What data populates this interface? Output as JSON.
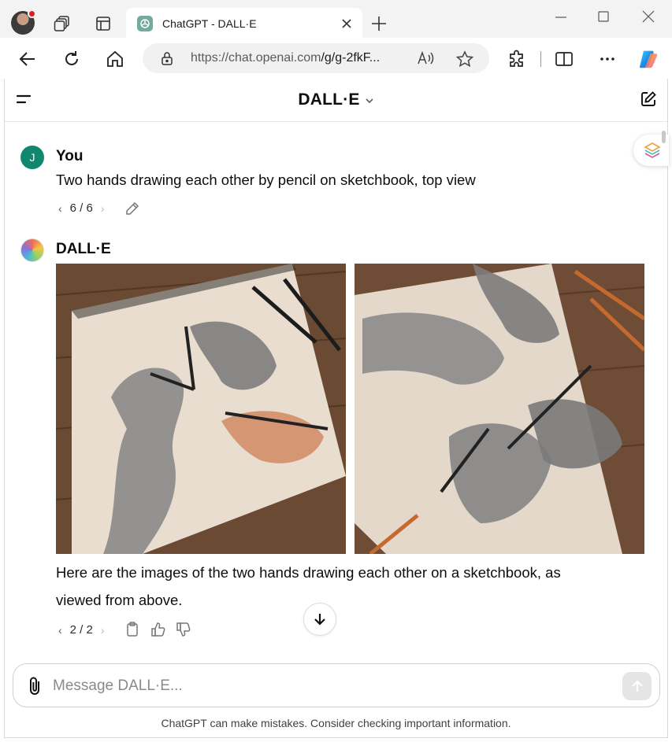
{
  "browser": {
    "tab_title": "ChatGPT - DALL·E",
    "url_host": "https://chat.openai.com",
    "url_path": "/g/g-2fkF..."
  },
  "app": {
    "title": "DALL·E"
  },
  "conversation": {
    "user": {
      "name": "You",
      "avatar_letter": "J",
      "text": "Two hands drawing each other by pencil on sketchbook, top view",
      "pager": "6 / 6"
    },
    "assistant": {
      "name": "DALL·E",
      "text_line1": "Here are the images of the two hands drawing each other on a sketchbook, as",
      "text_line2": "viewed from above.",
      "pager": "2 / 2"
    }
  },
  "composer": {
    "placeholder": "Message DALL·E..."
  },
  "footer": {
    "disclaimer": "ChatGPT can make mistakes. Consider checking important information."
  },
  "colors": {
    "user_avatar": "#11876f",
    "chatgpt_favicon": "#74aa9c",
    "copilot": "#1b8ef0"
  }
}
